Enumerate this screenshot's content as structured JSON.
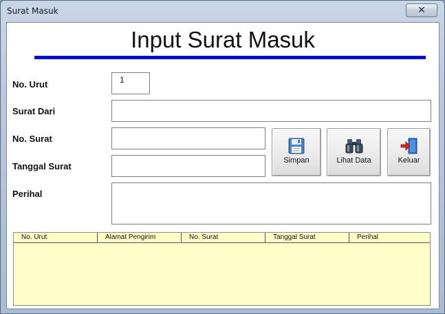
{
  "window": {
    "title": "Surat Masuk",
    "close_glyph": "✕"
  },
  "form": {
    "heading": "Input Surat Masuk",
    "accent_color": "#0010c8",
    "fields": {
      "no_urut": {
        "label": "No. Urut",
        "value": "1"
      },
      "surat_dari": {
        "label": "Surat Dari",
        "value": ""
      },
      "no_surat": {
        "label": "No. Surat",
        "value": ""
      },
      "tanggal_surat": {
        "label": "Tanggal Surat",
        "value": ""
      },
      "perihal": {
        "label": "Perihal",
        "value": ""
      }
    }
  },
  "buttons": {
    "simpan": {
      "label": "Simpan",
      "icon": "floppy-disk-icon"
    },
    "lihat_data": {
      "label": "Lihat Data",
      "icon": "binoculars-icon"
    },
    "keluar": {
      "label": "Keluar",
      "icon": "exit-door-icon"
    }
  },
  "grid": {
    "background": "#ffffc8",
    "columns": [
      "No. Urut",
      "Alamat Pengirim",
      "No. Surat",
      "Tanggal Surat",
      "Perihal"
    ],
    "rows": []
  }
}
